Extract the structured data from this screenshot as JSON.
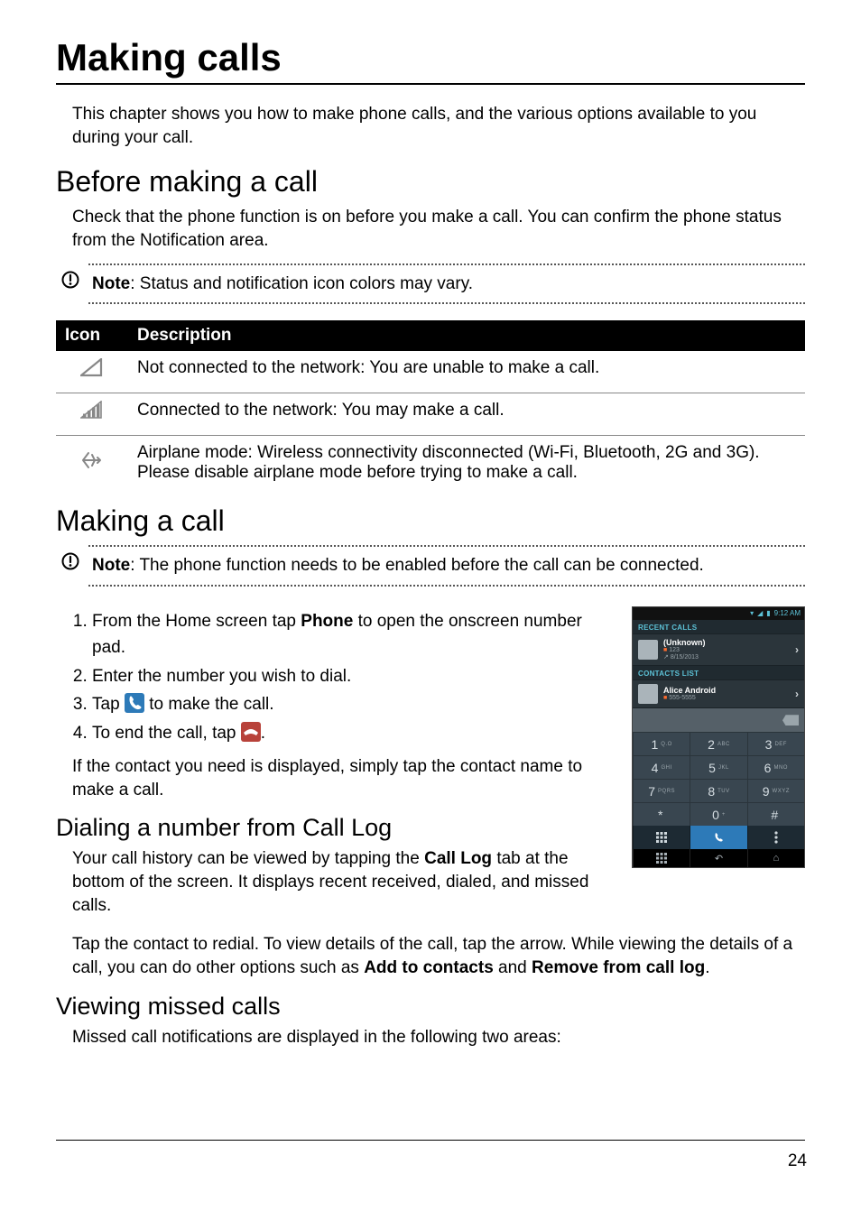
{
  "title": "Making calls",
  "intro": "This chapter shows you how to make phone calls, and the various options available to you during your call.",
  "section_before": {
    "heading": "Before making a call",
    "body": "Check that the phone function is on before you make a call. You can confirm the phone status from the Notification area.",
    "note_label": "Note",
    "note_text": ": Status and notification icon colors may vary."
  },
  "icon_table": {
    "head_icon": "Icon",
    "head_desc": "Description",
    "rows": [
      {
        "desc": "Not connected to the network: You are unable to make a call."
      },
      {
        "desc": "Connected to the network: You may make a call."
      },
      {
        "desc": "Airplane mode: Wireless connectivity disconnected (Wi-Fi, Bluetooth, 2G and 3G). Please disable airplane mode before trying to make a call."
      }
    ]
  },
  "section_making": {
    "heading": "Making a call",
    "note_label": "Note",
    "note_text": ": The phone function needs to be enabled before the call can be connected.",
    "steps": {
      "s1_a": "From the Home screen tap ",
      "s1_b": "Phone",
      "s1_c": " to open the onscreen number pad.",
      "s2": "Enter the number you wish to dial.",
      "s3_a": "Tap ",
      "s3_b": " to make the call.",
      "s4_a": "To end the call, tap ",
      "s4_b": "."
    },
    "after_steps": "If the contact you need is displayed, simply tap the contact name to make a call."
  },
  "section_dialing": {
    "heading": "Dialing a number from Call Log",
    "p1_a": "Your call history can be viewed by tapping the ",
    "p1_b": "Call Log",
    "p1_c": " tab at the bottom of the screen. It displays recent received, dialed, and missed calls.",
    "p2_a": "Tap the contact to redial. To view details of the call, tap the arrow. While viewing the details of a call, you can do other options such as ",
    "p2_b": "Add to contacts",
    "p2_c": " and ",
    "p2_d": "Remove from call log",
    "p2_e": "."
  },
  "section_missed": {
    "heading": "Viewing missed calls",
    "body": "Missed call notifications are displayed in the following two areas:"
  },
  "phone": {
    "status_time": "9:12 AM",
    "recent_label": "RECENT CALLS",
    "recent_name": "(Unknown)",
    "recent_sim": "■",
    "recent_num": "123",
    "recent_date": "8/15/2013",
    "contacts_label": "CONTACTS LIST",
    "contact_name": "Alice Android",
    "contact_sim": "■",
    "contact_num": "555-5555",
    "keys": [
      {
        "d": "1",
        "l": "Q.O"
      },
      {
        "d": "2",
        "l": "ABC"
      },
      {
        "d": "3",
        "l": "DEF"
      },
      {
        "d": "4",
        "l": "GHI"
      },
      {
        "d": "5",
        "l": "JKL"
      },
      {
        "d": "6",
        "l": "MNO"
      },
      {
        "d": "7",
        "l": "PQRS"
      },
      {
        "d": "8",
        "l": "TUV"
      },
      {
        "d": "9",
        "l": "WXYZ"
      },
      {
        "d": "*",
        "l": ""
      },
      {
        "d": "0",
        "l": "+"
      },
      {
        "d": "#",
        "l": ""
      }
    ]
  },
  "page_number": "24"
}
